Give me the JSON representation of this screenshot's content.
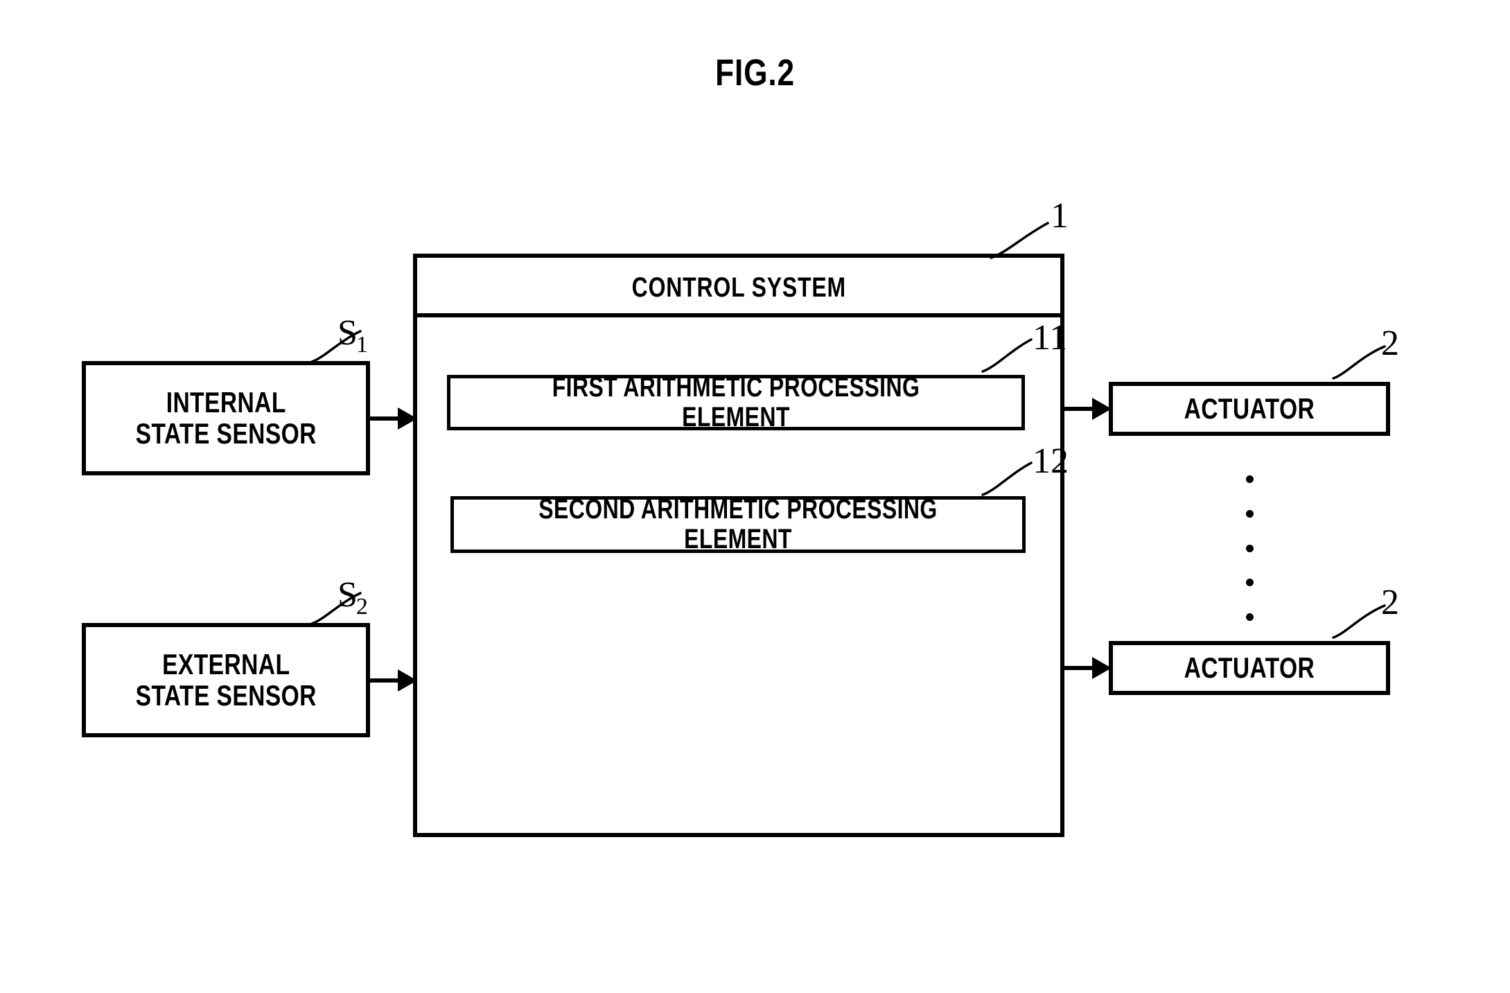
{
  "figure": {
    "title": "FIG.2",
    "type": "patent-block-diagram"
  },
  "control_system": {
    "title": "CONTROL SYSTEM",
    "callout": "1",
    "elements": [
      {
        "label": "FIRST ARITHMETIC PROCESSING ELEMENT",
        "callout": "11"
      },
      {
        "label": "SECOND ARITHMETIC PROCESSING ELEMENT",
        "callout": "12"
      }
    ]
  },
  "sensors": [
    {
      "label": "INTERNAL\nSTATE SENSOR",
      "callout_symbol": "S",
      "callout_subscript": "1"
    },
    {
      "label": "EXTERNAL\nSTATE SENSOR",
      "callout_symbol": "S",
      "callout_subscript": "2"
    }
  ],
  "actuators": [
    {
      "label": "ACTUATOR",
      "callout": "2"
    },
    {
      "label": "ACTUATOR",
      "callout": "2"
    }
  ],
  "ellipsis": {
    "dot_count": 5,
    "meaning": "additional actuators"
  },
  "connectors": [
    {
      "from": "internal-state-sensor",
      "to": "control-system",
      "style": "solid-arrow"
    },
    {
      "from": "external-state-sensor",
      "to": "control-system",
      "style": "solid-arrow"
    },
    {
      "from": "control-system",
      "to": "actuator-1",
      "style": "solid-arrow"
    },
    {
      "from": "control-system",
      "to": "actuator-2",
      "style": "solid-arrow"
    }
  ],
  "colors": {
    "ink": "#000000",
    "paper": "#ffffff"
  }
}
